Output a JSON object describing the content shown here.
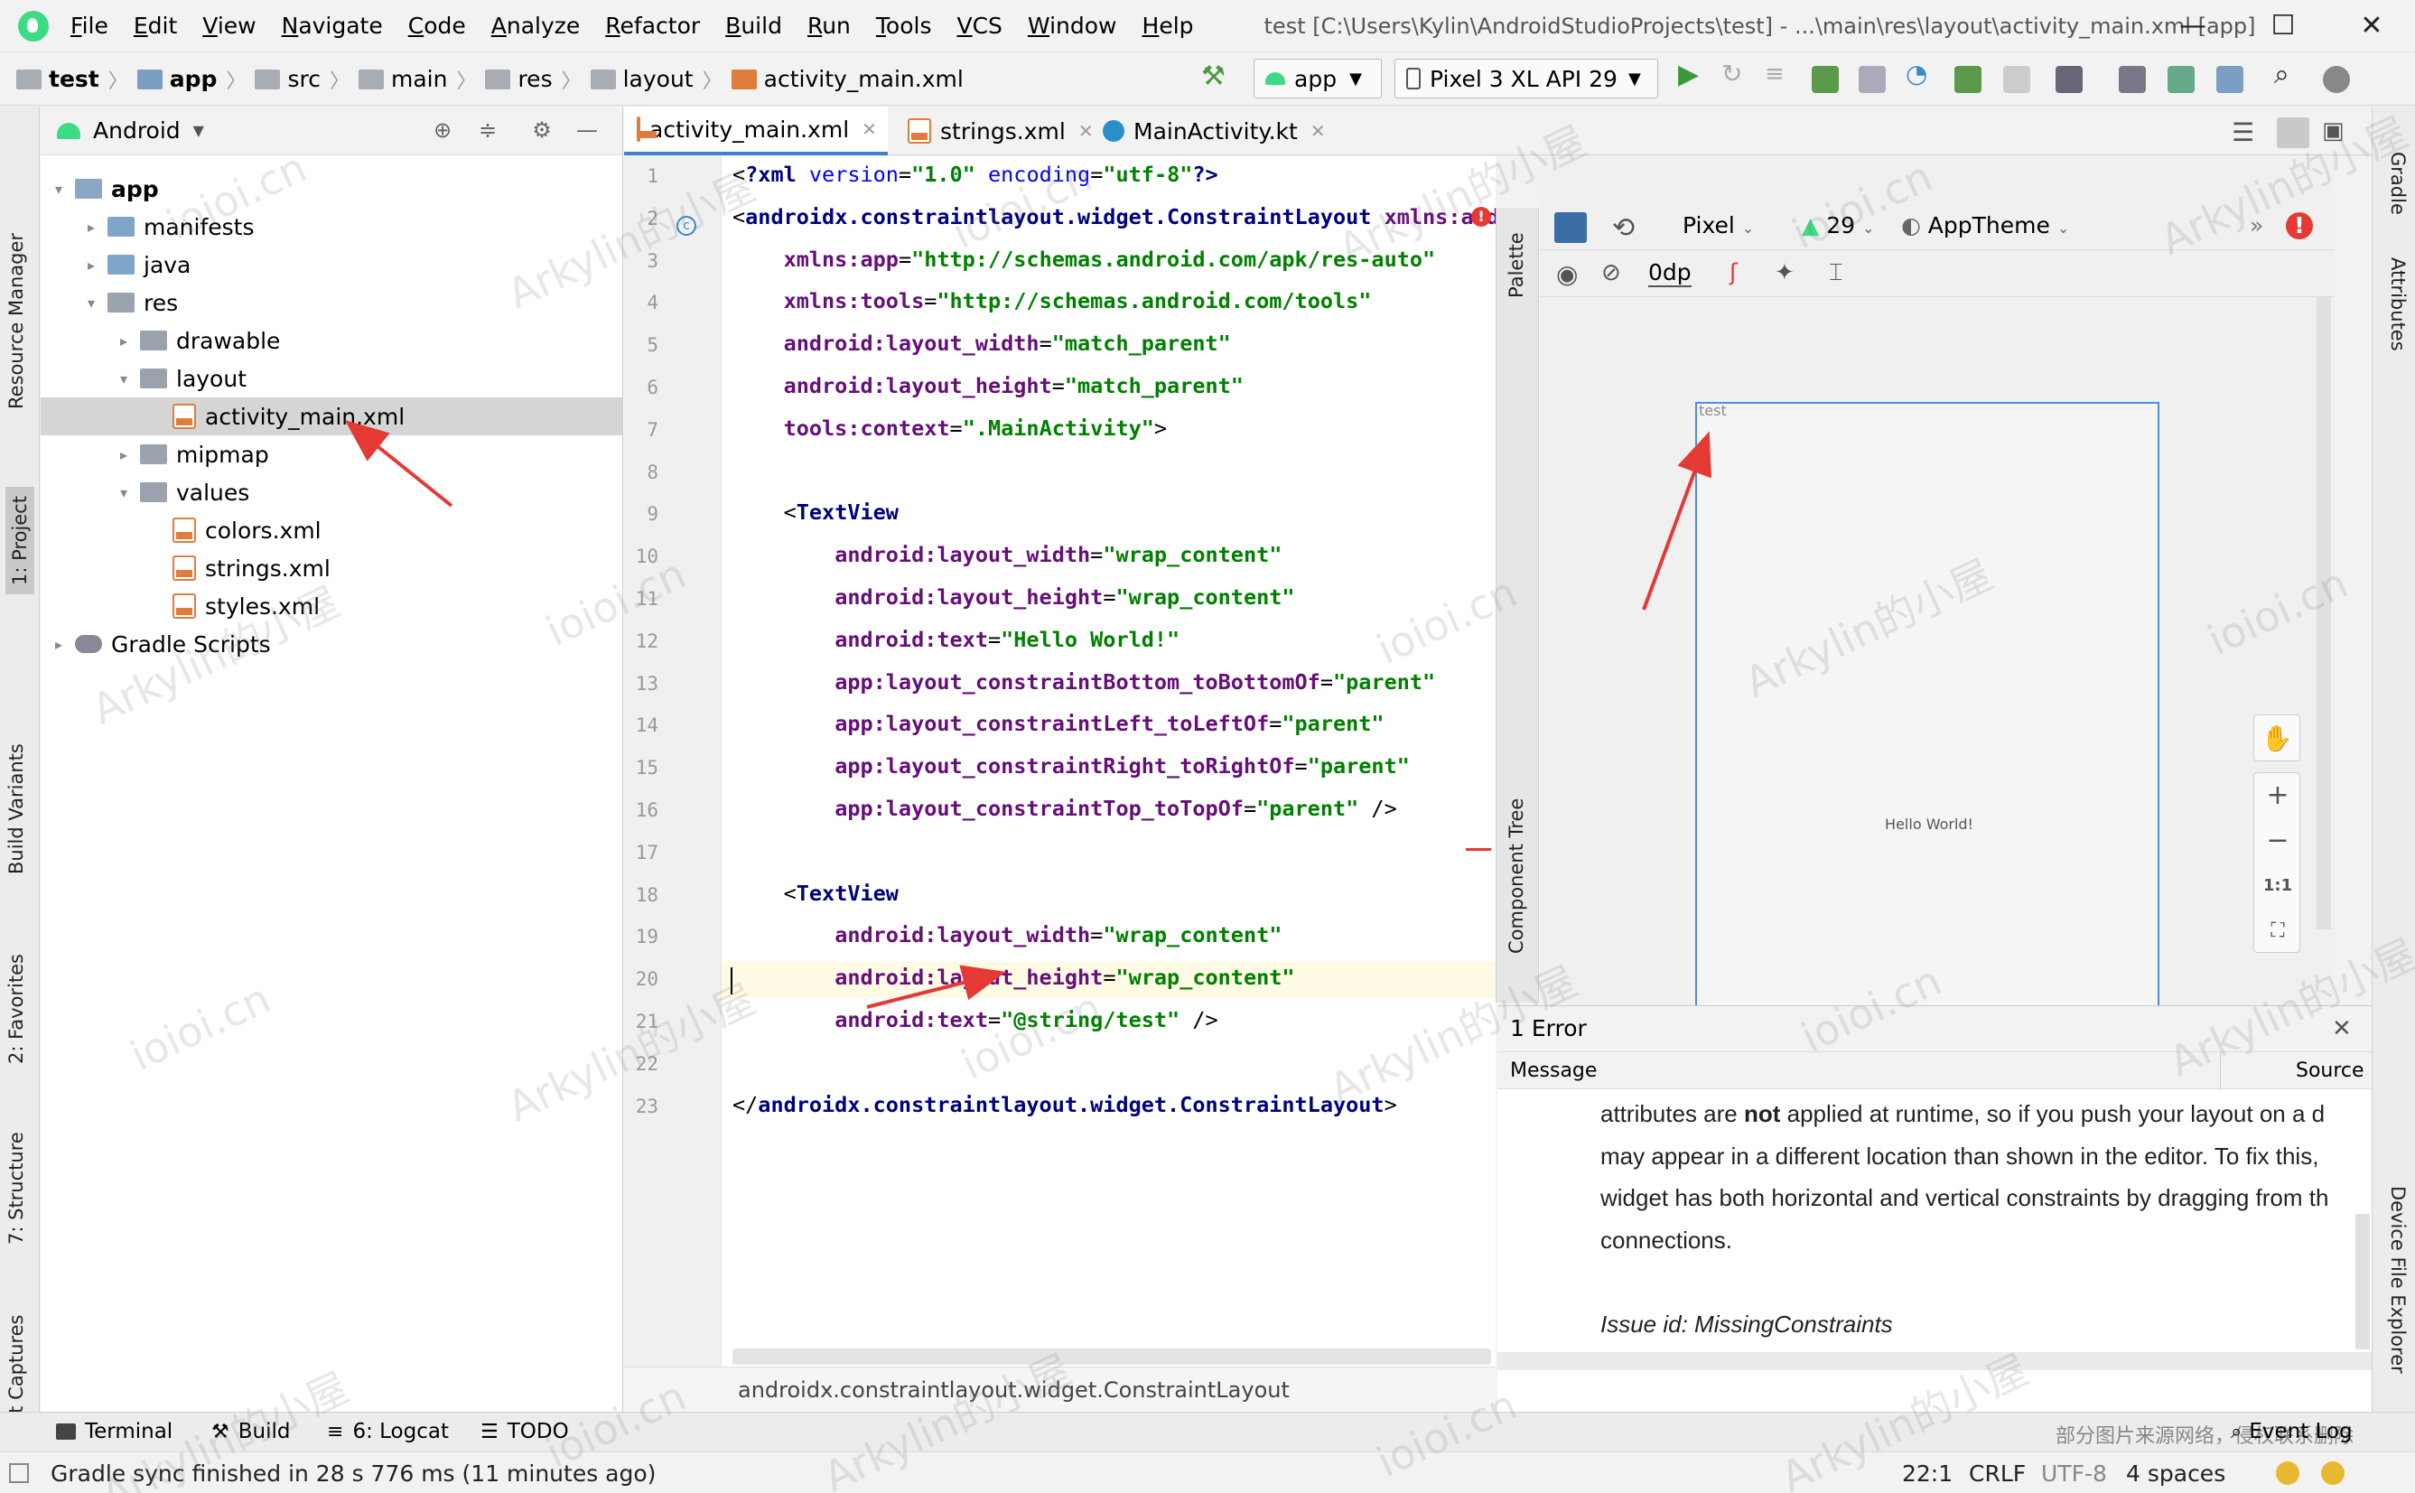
{
  "menubar": {
    "items": [
      "File",
      "Edit",
      "View",
      "Navigate",
      "Code",
      "Analyze",
      "Refactor",
      "Build",
      "Run",
      "Tools",
      "VCS",
      "Window",
      "Help"
    ],
    "title": "test [C:\\Users\\Kylin\\AndroidStudioProjects\\test] - ...\\main\\res\\layout\\activity_main.xml [app]"
  },
  "breadcrumbs": [
    "test",
    "app",
    "src",
    "main",
    "res",
    "layout",
    "activity_main.xml"
  ],
  "toolbar": {
    "config": "app",
    "device": "Pixel 3 XL API 29"
  },
  "left_strip": [
    "Resource Manager",
    "1: Project",
    "Build Variants",
    "2: Favorites",
    "7: Structure",
    "Layout Captures"
  ],
  "right_strip": [
    "Gradle",
    "Attributes",
    "Device File Explorer"
  ],
  "project": {
    "view_mode": "Android",
    "tree": [
      {
        "label": "app",
        "arrow": "▾",
        "icon": "mod"
      },
      {
        "label": "manifests",
        "arrow": "▸",
        "icon": "folder"
      },
      {
        "label": "java",
        "arrow": "▸",
        "icon": "folder"
      },
      {
        "label": "res",
        "arrow": "▾",
        "icon": "gray"
      },
      {
        "label": "drawable",
        "arrow": "▸",
        "icon": "gray"
      },
      {
        "label": "layout",
        "arrow": "▾",
        "icon": "gray"
      },
      {
        "label": "activity_main.xml",
        "arrow": "",
        "icon": "xml"
      },
      {
        "label": "mipmap",
        "arrow": "▸",
        "icon": "gray"
      },
      {
        "label": "values",
        "arrow": "▾",
        "icon": "gray"
      },
      {
        "label": "colors.xml",
        "arrow": "",
        "icon": "xml"
      },
      {
        "label": "strings.xml",
        "arrow": "",
        "icon": "xml"
      },
      {
        "label": "styles.xml",
        "arrow": "",
        "icon": "xml"
      },
      {
        "label": "Gradle Scripts",
        "arrow": "▸",
        "icon": "gradle"
      }
    ]
  },
  "tabs": [
    {
      "label": "activity_main.xml"
    },
    {
      "label": "strings.xml"
    },
    {
      "label": "MainActivity.kt"
    }
  ],
  "editor": {
    "line_numbers": [
      "1",
      "2",
      "3",
      "4",
      "5",
      "6",
      "7",
      "8",
      "9",
      "10",
      "11",
      "12",
      "13",
      "14",
      "15",
      "16",
      "17",
      "18",
      "19",
      "20",
      "21",
      "22",
      "23"
    ],
    "lines": [
      [
        [
          "c-pun",
          "<"
        ],
        [
          "c-tag",
          "?xml "
        ],
        [
          "c-at",
          "version"
        ],
        [
          "c-pun",
          "="
        ],
        [
          "c-val",
          "\"1.0\""
        ],
        [
          "c-pun",
          " "
        ],
        [
          "c-at",
          "encoding"
        ],
        [
          "c-pun",
          "="
        ],
        [
          "c-val",
          "\"utf-8\""
        ],
        [
          "c-tag",
          "?>"
        ]
      ],
      [
        [
          "c-pun",
          "<"
        ],
        [
          "c-tag",
          "androidx.constraintlayout.widget.ConstraintLayout "
        ],
        [
          "c-ns",
          "xmlns:andr"
        ]
      ],
      [
        [
          "c-pun",
          "    "
        ],
        [
          "c-ns",
          "xmlns:app"
        ],
        [
          "c-pun",
          "="
        ],
        [
          "c-val",
          "\"http://schemas.android.com/apk/res-auto\""
        ]
      ],
      [
        [
          "c-pun",
          "    "
        ],
        [
          "c-ns",
          "xmlns:tools"
        ],
        [
          "c-pun",
          "="
        ],
        [
          "c-val",
          "\"http://schemas.android.com/tools\""
        ]
      ],
      [
        [
          "c-pun",
          "    "
        ],
        [
          "c-ns",
          "android:layout_width"
        ],
        [
          "c-pun",
          "="
        ],
        [
          "c-val",
          "\"match_parent\""
        ]
      ],
      [
        [
          "c-pun",
          "    "
        ],
        [
          "c-ns",
          "android:layout_height"
        ],
        [
          "c-pun",
          "="
        ],
        [
          "c-val",
          "\"match_parent\""
        ]
      ],
      [
        [
          "c-pun",
          "    "
        ],
        [
          "c-ns",
          "tools:context"
        ],
        [
          "c-pun",
          "="
        ],
        [
          "c-val",
          "\".MainActivity\""
        ],
        [
          "c-pun",
          ">"
        ]
      ],
      [],
      [
        [
          "c-pun",
          "    <"
        ],
        [
          "c-tag",
          "TextView"
        ]
      ],
      [
        [
          "c-pun",
          "        "
        ],
        [
          "c-ns",
          "android:layout_width"
        ],
        [
          "c-pun",
          "="
        ],
        [
          "c-val",
          "\"wrap_content\""
        ]
      ],
      [
        [
          "c-pun",
          "        "
        ],
        [
          "c-ns",
          "android:layout_height"
        ],
        [
          "c-pun",
          "="
        ],
        [
          "c-val",
          "\"wrap_content\""
        ]
      ],
      [
        [
          "c-pun",
          "        "
        ],
        [
          "c-ns",
          "android:text"
        ],
        [
          "c-pun",
          "="
        ],
        [
          "c-val",
          "\"Hello World!\""
        ]
      ],
      [
        [
          "c-pun",
          "        "
        ],
        [
          "c-ns",
          "app:layout_constraintBottom_toBottomOf"
        ],
        [
          "c-pun",
          "="
        ],
        [
          "c-val",
          "\"parent\""
        ]
      ],
      [
        [
          "c-pun",
          "        "
        ],
        [
          "c-ns",
          "app:layout_constraintLeft_toLeftOf"
        ],
        [
          "c-pun",
          "="
        ],
        [
          "c-val",
          "\"parent\""
        ]
      ],
      [
        [
          "c-pun",
          "        "
        ],
        [
          "c-ns",
          "app:layout_constraintRight_toRightOf"
        ],
        [
          "c-pun",
          "="
        ],
        [
          "c-val",
          "\"parent\""
        ]
      ],
      [
        [
          "c-pun",
          "        "
        ],
        [
          "c-ns",
          "app:layout_constraintTop_toTopOf"
        ],
        [
          "c-pun",
          "="
        ],
        [
          "c-val",
          "\"parent\""
        ],
        [
          "c-pun",
          " />"
        ]
      ],
      [],
      [
        [
          "c-pun",
          "    <"
        ],
        [
          "c-tag",
          "TextView"
        ]
      ],
      [
        [
          "c-pun",
          "        "
        ],
        [
          "c-ns",
          "android:layout_width"
        ],
        [
          "c-pun",
          "="
        ],
        [
          "c-val",
          "\"wrap_content\""
        ]
      ],
      [
        [
          "c-pun",
          "        "
        ],
        [
          "c-ns",
          "android:layout_height"
        ],
        [
          "c-pun",
          "="
        ],
        [
          "c-val",
          "\"wrap_content\""
        ]
      ],
      [
        [
          "c-pun",
          "        "
        ],
        [
          "c-ns",
          "android:text"
        ],
        [
          "c-pun",
          "="
        ],
        [
          "c-val",
          "\"@string/test\""
        ],
        [
          "c-pun",
          " />"
        ]
      ],
      [],
      [
        [
          "c-pun",
          "</"
        ],
        [
          "c-tag",
          "androidx.constraintlayout.widget.ConstraintLayout"
        ],
        [
          "c-pun",
          ">"
        ]
      ]
    ],
    "breadcrumb": "androidx.constraintlayout.widget.ConstraintLayout"
  },
  "side_tabs": {
    "palette": "Palette",
    "component_tree": "Component Tree"
  },
  "design": {
    "device": "Pixel",
    "api": "29",
    "theme": "AppTheme",
    "margin": "0dp",
    "preview_texts": {
      "test": "test",
      "hello": "Hello World!"
    },
    "zoom": {
      "plus": "+",
      "minus": "−",
      "one_to_one": "1:1"
    }
  },
  "errors": {
    "count_label": "1 Error",
    "col_message": "Message",
    "col_source": "Source",
    "lines": [
      "attributes are not applied at runtime, so if you push your layout on a d",
      "may appear in a different location than shown in the editor. To fix this,",
      "widget has both horizontal and vertical constraints by dragging from th",
      "connections.",
      "",
      "Issue id: MissingConstraints"
    ]
  },
  "bottom_tools": [
    "Terminal",
    "Build",
    "6: Logcat",
    "TODO"
  ],
  "status": {
    "message": "Gradle sync finished in 28 s 776 ms (11 minutes ago)",
    "position": "22:1",
    "line_sep": "CRLF",
    "encoding": "UTF-8",
    "indent": "4 spaces",
    "event_log": "Event Log",
    "notice": "部分图片来源网络，侵权联系删除"
  },
  "watermarks": [
    "Arkylin的小屋",
    "ioioi.cn"
  ],
  "colors": {
    "accent": "#4083c9",
    "error": "#e53935",
    "android": "#3ddc84",
    "arrow": "#e53935"
  }
}
